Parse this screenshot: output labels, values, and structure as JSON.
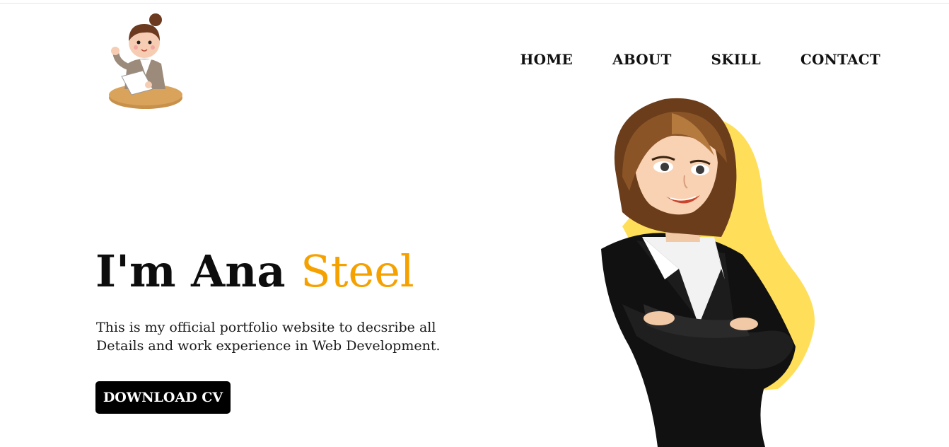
{
  "nav": {
    "items": [
      {
        "label": "HOME"
      },
      {
        "label": "ABOUT"
      },
      {
        "label": "SKILL"
      },
      {
        "label": "CONTACT"
      }
    ]
  },
  "hero": {
    "title_prefix": "I'm Ana ",
    "title_accent": "Steel",
    "description": "This is my official portfolio website to decsribe all Details and work experience in Web Development.",
    "cta_label": "DOWNLOAD CV"
  },
  "colors": {
    "accent": "#f5a100",
    "blob": "#ffde59",
    "button_bg": "#000000",
    "button_text": "#ffffff"
  },
  "icons": {
    "logo": "cartoon-woman-at-desk-logo",
    "hero_image": "businesswoman-illustration"
  }
}
